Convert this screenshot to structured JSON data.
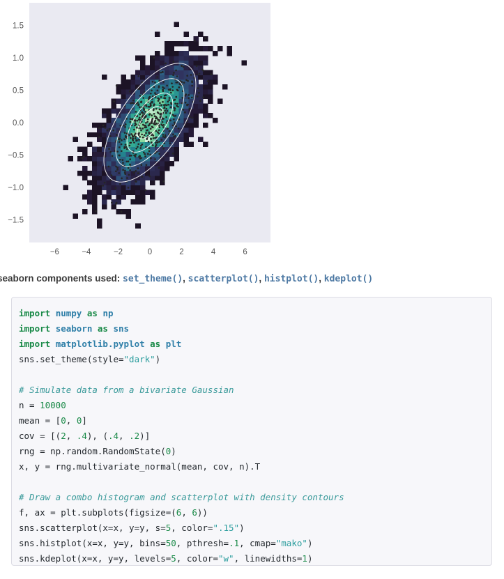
{
  "chart_data": {
    "type": "scatter",
    "title": "",
    "xlabel": "",
    "ylabel": "",
    "xlim": [
      -7.6,
      7.6
    ],
    "ylim": [
      -1.85,
      1.85
    ],
    "xticks": [
      "−6",
      "−4",
      "−2",
      "0",
      "2",
      "4",
      "6"
    ],
    "xtick_values": [
      -6,
      -4,
      -2,
      0,
      2,
      4,
      6
    ],
    "yticks": [
      "1.5",
      "1.0",
      "0.5",
      "0.0",
      "−0.5",
      "−1.0",
      "−1.5"
    ],
    "ytick_values": [
      1.5,
      1.0,
      0.5,
      0.0,
      -0.5,
      -1.0,
      -1.5
    ],
    "grid": false,
    "legend": "none",
    "axes_facecolor": "#eaeaf2",
    "figure_facecolor": "#ffffff",
    "tick_label_color": "#555555",
    "n_points": 10000,
    "distribution": "bivariate Gaussian",
    "mean": [
      0,
      0
    ],
    "cov": [
      [
        2,
        0.4
      ],
      [
        0.4,
        0.2
      ]
    ],
    "scatter": {
      "marker_size": 5,
      "color": "#262626",
      "opacity": 1
    },
    "histogram": {
      "bins": 50,
      "pthresh": 0.1,
      "cmap": "mako",
      "cmap_stops": [
        "#0b0405",
        "#251a36",
        "#30335f",
        "#2d5980",
        "#23848f",
        "#35b294",
        "#8cd9a0",
        "#def5e5"
      ]
    },
    "kde": {
      "levels": 5,
      "color": "w",
      "linewidths": 1,
      "contour_count": 4,
      "orientation_deg": -58
    }
  },
  "components": {
    "lead": "seaborn components used:",
    "items": [
      {
        "label": "set_theme()"
      },
      {
        "label": "scatterplot()"
      },
      {
        "label": "histplot()"
      },
      {
        "label": "kdeplot()"
      }
    ],
    "separator": ","
  },
  "code": {
    "language": "python",
    "lines": [
      [
        {
          "t": "import ",
          "c": "kw"
        },
        {
          "t": "numpy",
          "c": "mod"
        },
        {
          "t": " ",
          "c": "pl"
        },
        {
          "t": "as",
          "c": "kw"
        },
        {
          "t": " ",
          "c": "pl"
        },
        {
          "t": "np",
          "c": "mod"
        }
      ],
      [
        {
          "t": "import ",
          "c": "kw"
        },
        {
          "t": "seaborn",
          "c": "mod"
        },
        {
          "t": " ",
          "c": "pl"
        },
        {
          "t": "as",
          "c": "kw"
        },
        {
          "t": " ",
          "c": "pl"
        },
        {
          "t": "sns",
          "c": "mod"
        }
      ],
      [
        {
          "t": "import ",
          "c": "kw"
        },
        {
          "t": "matplotlib.pyplot",
          "c": "mod"
        },
        {
          "t": " ",
          "c": "pl"
        },
        {
          "t": "as",
          "c": "kw"
        },
        {
          "t": " ",
          "c": "pl"
        },
        {
          "t": "plt",
          "c": "mod"
        }
      ],
      [
        {
          "t": "sns.set_theme(style=",
          "c": "pl"
        },
        {
          "t": "\"dark\"",
          "c": "str"
        },
        {
          "t": ")",
          "c": "pl"
        }
      ],
      [],
      [
        {
          "t": "# Simulate data from a bivariate Gaussian",
          "c": "cm"
        }
      ],
      [
        {
          "t": "n = ",
          "c": "pl"
        },
        {
          "t": "10000",
          "c": "num"
        }
      ],
      [
        {
          "t": "mean = [",
          "c": "pl"
        },
        {
          "t": "0",
          "c": "num"
        },
        {
          "t": ", ",
          "c": "pl"
        },
        {
          "t": "0",
          "c": "num"
        },
        {
          "t": "]",
          "c": "pl"
        }
      ],
      [
        {
          "t": "cov = [(",
          "c": "pl"
        },
        {
          "t": "2",
          "c": "num"
        },
        {
          "t": ", ",
          "c": "pl"
        },
        {
          "t": ".4",
          "c": "num"
        },
        {
          "t": "), (",
          "c": "pl"
        },
        {
          "t": ".4",
          "c": "num"
        },
        {
          "t": ", ",
          "c": "pl"
        },
        {
          "t": ".2",
          "c": "num"
        },
        {
          "t": ")]",
          "c": "pl"
        }
      ],
      [
        {
          "t": "rng = np.random.RandomState(",
          "c": "pl"
        },
        {
          "t": "0",
          "c": "num"
        },
        {
          "t": ")",
          "c": "pl"
        }
      ],
      [
        {
          "t": "x, y = rng.multivariate_normal(mean, cov, n).T",
          "c": "pl"
        }
      ],
      [],
      [
        {
          "t": "# Draw a combo histogram and scatterplot with density contours",
          "c": "cm"
        }
      ],
      [
        {
          "t": "f, ax = plt.subplots(figsize=(",
          "c": "pl"
        },
        {
          "t": "6",
          "c": "num"
        },
        {
          "t": ", ",
          "c": "pl"
        },
        {
          "t": "6",
          "c": "num"
        },
        {
          "t": "))",
          "c": "pl"
        }
      ],
      [
        {
          "t": "sns.scatterplot(x=x, y=y, s=",
          "c": "pl"
        },
        {
          "t": "5",
          "c": "num"
        },
        {
          "t": ", color=",
          "c": "pl"
        },
        {
          "t": "\".15\"",
          "c": "str"
        },
        {
          "t": ")",
          "c": "pl"
        }
      ],
      [
        {
          "t": "sns.histplot(x=x, y=y, bins=",
          "c": "pl"
        },
        {
          "t": "50",
          "c": "num"
        },
        {
          "t": ", pthresh=",
          "c": "pl"
        },
        {
          "t": ".1",
          "c": "num"
        },
        {
          "t": ", cmap=",
          "c": "pl"
        },
        {
          "t": "\"mako\"",
          "c": "str"
        },
        {
          "t": ")",
          "c": "pl"
        }
      ],
      [
        {
          "t": "sns.kdeplot(x=x, y=y, levels=",
          "c": "pl"
        },
        {
          "t": "5",
          "c": "num"
        },
        {
          "t": ", color=",
          "c": "pl"
        },
        {
          "t": "\"w\"",
          "c": "str"
        },
        {
          "t": ", linewidths=",
          "c": "pl"
        },
        {
          "t": "1",
          "c": "num"
        },
        {
          "t": ")",
          "c": "pl"
        }
      ]
    ]
  }
}
